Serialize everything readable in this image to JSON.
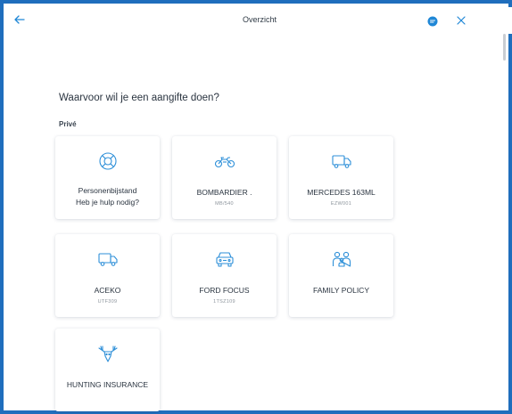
{
  "header": {
    "title": "Overzicht",
    "accent": "#1f87d6"
  },
  "main": {
    "heading": "Waarvoor wil je een aangifte doen?",
    "section_label": "Privé",
    "cards": [
      {
        "icon": "lifebuoy-icon",
        "title_line1": "Personenbijstand",
        "title_line2": "Heb je hulp nodig?"
      },
      {
        "icon": "motorcycle-icon",
        "title": "BOMBARDIER .",
        "subtitle": "MB/540"
      },
      {
        "icon": "truck-icon",
        "title": "MERCEDES 163ML",
        "subtitle": "EZW001"
      },
      {
        "icon": "truck-icon",
        "title": "ACEKO",
        "subtitle": "UTF309"
      },
      {
        "icon": "car-icon",
        "title": "FORD FOCUS",
        "subtitle": "1TSZ109"
      },
      {
        "icon": "family-icon",
        "title": "FAMILY POLICY"
      },
      {
        "icon": "deer-icon",
        "title": "HUNTING INSURANCE"
      }
    ]
  },
  "colors": {
    "frame": "#1f6ebd",
    "icon": "#2d8fd8",
    "text": "#2a3440",
    "subtext": "#8c949c"
  }
}
